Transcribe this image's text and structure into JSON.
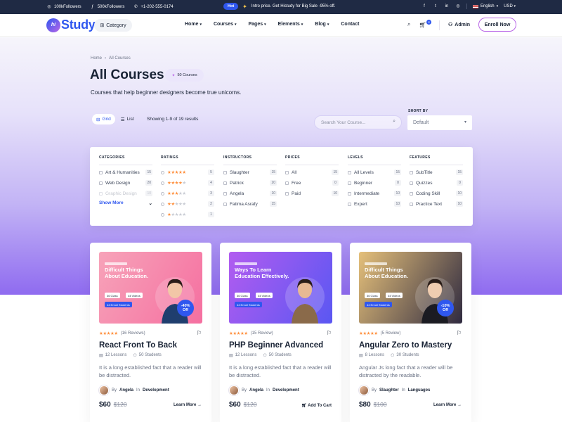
{
  "topbar": {
    "instagram": "100kFollowers",
    "facebook": "500kFollowers",
    "phone": "+1-202-555-0174",
    "hot_badge": "Hot",
    "promo": "Intro price. Get Histudy for Big Sale -95% off.",
    "language": "English",
    "currency": "USD"
  },
  "header": {
    "logo_badge": "hi",
    "logo_word": "Study",
    "category_label": "Category",
    "nav": [
      "Home",
      "Courses",
      "Pages",
      "Elements",
      "Blog",
      "Contact"
    ],
    "cart_count": "4",
    "admin_label": "Admin",
    "enroll_label": "Enroll Now"
  },
  "hero": {
    "breadcrumb_home": "Home",
    "breadcrumb_sep": "›",
    "breadcrumb_current": "All Courses",
    "title": "All Courses",
    "course_count": "50 Courses",
    "subtitle": "Courses that help beginner designers become true unicorns.",
    "view_grid": "Grid",
    "view_list": "List",
    "showing": "Showing 1-9 of 19 results",
    "search_placeholder": "Search Your Course...",
    "short_by_label": "SHORT BY",
    "short_by_value": "Default"
  },
  "filters": {
    "categories": {
      "title": "CATEGORIES",
      "items": [
        {
          "label": "Art & Humanities",
          "count": "15"
        },
        {
          "label": "Web Design",
          "count": "20"
        },
        {
          "label": "Graphic Design",
          "count": "10"
        }
      ],
      "show_more": "Show More"
    },
    "ratings": {
      "title": "RATINGS",
      "items": [
        {
          "stars": 5,
          "count": "5"
        },
        {
          "stars": 4,
          "count": "4"
        },
        {
          "stars": 3,
          "count": "3"
        },
        {
          "stars": 2,
          "count": "2"
        },
        {
          "stars": 1,
          "count": "1"
        }
      ]
    },
    "instructors": {
      "title": "INSTRUCTORS",
      "items": [
        {
          "label": "Slaughter",
          "count": "15"
        },
        {
          "label": "Patrick",
          "count": "20"
        },
        {
          "label": "Angela",
          "count": "10"
        },
        {
          "label": "Fatima Asrafy",
          "count": "15"
        }
      ]
    },
    "prices": {
      "title": "PRICES",
      "items": [
        {
          "label": "All",
          "count": "15"
        },
        {
          "label": "Free",
          "count": "0"
        },
        {
          "label": "Paid",
          "count": "10"
        }
      ]
    },
    "levels": {
      "title": "LEVELS",
      "items": [
        {
          "label": "All Levels",
          "count": "15"
        },
        {
          "label": "Beginner",
          "count": "0"
        },
        {
          "label": "Intermediate",
          "count": "10"
        },
        {
          "label": "Expert",
          "count": "10"
        }
      ]
    },
    "features": {
      "title": "FEATURES",
      "items": [
        {
          "label": "SubTitle",
          "count": "15"
        },
        {
          "label": "Quizzes",
          "count": "0"
        },
        {
          "label": "Coding Skill",
          "count": "10"
        },
        {
          "label": "Practice Text",
          "count": "10"
        }
      ]
    }
  },
  "courses": [
    {
      "thumb_title": "Difficult Things About Education.",
      "thumb_colors": [
        "#f7a3b9",
        "#f56fa0"
      ],
      "chip1": "36 Class",
      "chip2": "44 Videos",
      "chip3": "44 Enroll Students",
      "discount": "-40%",
      "discount_sub": "Off",
      "reviews": "(16 Reviews)",
      "title": "React Front To Back",
      "lessons": "12 Lessons",
      "students": "50 Students",
      "description": "It is a long established fact that a reader will be distracted.",
      "author_by": "By",
      "author": "Angela",
      "author_in": "In",
      "category": "Development",
      "price": "$60",
      "old_price": "$120",
      "cta": "Learn More"
    },
    {
      "thumb_title": "Ways To Learn Education Effectively.",
      "thumb_colors": [
        "#b25cf0",
        "#5a57f2"
      ],
      "chip1": "36 Class",
      "chip2": "44 Videos",
      "chip3": "44 Enroll Students",
      "discount": "",
      "discount_sub": "",
      "reviews": "(15 Review)",
      "title": "PHP Beginner Advanced",
      "lessons": "12 Lessons",
      "students": "50 Students",
      "description": "It is a long established fact that a reader will be distracted.",
      "author_by": "By",
      "author": "Angela",
      "author_in": "In",
      "category": "Development",
      "price": "$60",
      "old_price": "$120",
      "cta": "Add To Cart"
    },
    {
      "thumb_title": "Difficult Things About Education.",
      "thumb_colors": [
        "#e5c07a",
        "#2f2a40"
      ],
      "chip1": "36 Class",
      "chip2": "44 Videos",
      "chip3": "44 Enroll Students",
      "discount": "-10%",
      "discount_sub": "Off",
      "reviews": "(5 Review)",
      "title": "Angular Zero to Mastery",
      "lessons": "8 Lessons",
      "students": "30 Students",
      "description": "Angular Js long fact that a reader will be distracted by the readable.",
      "author_by": "By",
      "author": "Slaughter",
      "author_in": "In",
      "category": "Languages",
      "price": "$80",
      "old_price": "$100",
      "cta": "Learn More"
    }
  ],
  "colors": {
    "primary": "#2f57ef",
    "accent": "#b966e7",
    "star": "#ff8f3c",
    "dark": "#1f2a44"
  }
}
